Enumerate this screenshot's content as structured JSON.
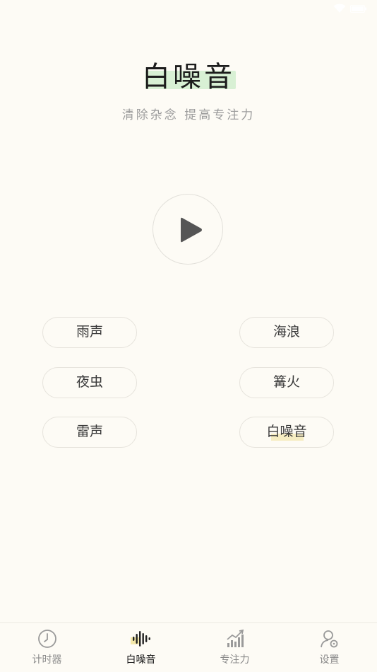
{
  "app": {
    "title": "白噪音",
    "subtitle": "清除杂念 提高专注力"
  },
  "player": {
    "state": "paused",
    "play_icon": "play-icon"
  },
  "sounds": [
    {
      "label": "雨声",
      "selected": false
    },
    {
      "label": "海浪",
      "selected": false
    },
    {
      "label": "夜虫",
      "selected": false
    },
    {
      "label": "篝火",
      "selected": false
    },
    {
      "label": "雷声",
      "selected": false
    },
    {
      "label": "白噪音",
      "selected": true
    }
  ],
  "tabs": [
    {
      "label": "计时器",
      "icon": "clock-icon",
      "active": false
    },
    {
      "label": "白噪音",
      "icon": "sound-wave-icon",
      "active": true
    },
    {
      "label": "专注力",
      "icon": "chart-trend-icon",
      "active": false
    },
    {
      "label": "设置",
      "icon": "user-settings-icon",
      "active": false
    }
  ],
  "colors": {
    "background": "#fdfbf5",
    "title_highlight": "#d8f0d4",
    "active_highlight": "#f4e8a8",
    "inactive_text": "#8a8a8a",
    "active_text": "#1a1a1a"
  }
}
